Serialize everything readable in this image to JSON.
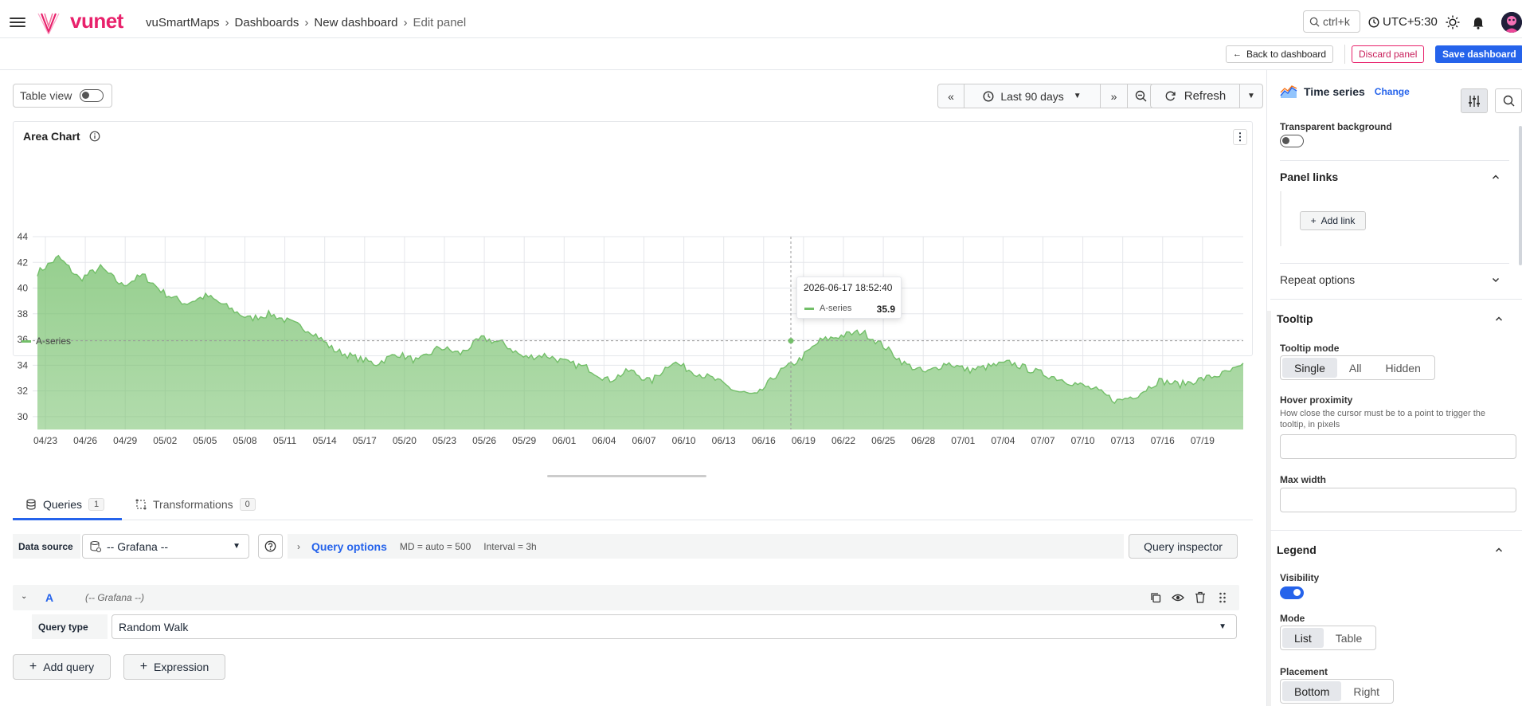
{
  "topbar": {
    "brand": "vunet",
    "breadcrumbs": [
      "vuSmartMaps",
      "Dashboards",
      "New dashboard",
      "Edit panel"
    ],
    "search_label": "ctrl+k",
    "timezone": "UTC+5:30"
  },
  "actionbar": {
    "back_label": "Back to dashboard",
    "discard_label": "Discard panel",
    "save_label": "Save dashboard"
  },
  "toolbar": {
    "table_view_label": "Table view",
    "time_range": "Last 90 days",
    "refresh_label": "Refresh"
  },
  "panel": {
    "title": "Area Chart",
    "tooltip": {
      "time": "2026-06-17 18:52:40",
      "series": "A-series",
      "value": "35.9"
    },
    "legend_label": "A-series"
  },
  "chart_data": {
    "type": "area",
    "series": [
      {
        "name": "A-series",
        "color": "#73bf69"
      }
    ],
    "x_tick_labels": [
      "04/23",
      "04/26",
      "04/29",
      "05/02",
      "05/05",
      "05/08",
      "05/11",
      "05/14",
      "05/17",
      "05/20",
      "05/23",
      "05/26",
      "05/29",
      "06/01",
      "06/04",
      "06/07",
      "06/10",
      "06/13",
      "06/16",
      "06/19",
      "06/22",
      "06/25",
      "06/28",
      "07/01",
      "07/04",
      "07/07",
      "07/10",
      "07/13",
      "07/16",
      "07/19"
    ],
    "y_tick_labels": [
      "44",
      "42",
      "40",
      "38",
      "36",
      "34",
      "32",
      "30"
    ],
    "ylim": [
      29,
      44
    ],
    "values": [
      41.2,
      42.4,
      40.7,
      41.6,
      40.2,
      41.0,
      39.6,
      38.8,
      39.4,
      38.5,
      37.6,
      38.0,
      37.3,
      36.6,
      35.2,
      34.6,
      34.1,
      34.9,
      34.3,
      35.4,
      34.9,
      36.1,
      35.7,
      34.6,
      34.8,
      34.2,
      33.8,
      32.8,
      33.6,
      32.7,
      34.3,
      33.5,
      32.9,
      32.0,
      31.6,
      33.4,
      34.4,
      35.9,
      36.3,
      36.6,
      35.5,
      34.1,
      33.4,
      34.2,
      33.6,
      33.9,
      34.2,
      33.6,
      33.1,
      32.6,
      32.1,
      31.2,
      31.7,
      32.8,
      32.5,
      32.9,
      33.3,
      33.9
    ],
    "grid": true,
    "legend_position": "bottom"
  },
  "queries": {
    "tabs": [
      {
        "label": "Queries",
        "count": "1"
      },
      {
        "label": "Transformations",
        "count": "0"
      }
    ],
    "data_source_label": "Data source",
    "data_source_value": "-- Grafana --",
    "query_options_label": "Query options",
    "md_text": "MD = auto = 500",
    "interval_text": "Interval = 3h",
    "inspector_label": "Query inspector",
    "query_letter": "A",
    "query_ds": "(-- Grafana --)",
    "query_type_label": "Query type",
    "query_type_value": "Random Walk",
    "add_query_label": "Add query",
    "expression_label": "Expression"
  },
  "options": {
    "viz_name": "Time series",
    "change_label": "Change",
    "transparent_label": "Transparent background",
    "panel_links_label": "Panel links",
    "add_link_label": "Add link",
    "repeat_label": "Repeat options",
    "tooltip_label": "Tooltip",
    "tooltip_mode_label": "Tooltip mode",
    "tooltip_modes": [
      "Single",
      "All",
      "Hidden"
    ],
    "hover_label": "Hover proximity",
    "hover_desc": "How close the cursor must be to a point to trigger the tooltip, in pixels",
    "max_width_label": "Max width",
    "legend_label": "Legend",
    "visibility_label": "Visibility",
    "mode_label": "Mode",
    "modes": [
      "List",
      "Table"
    ],
    "placement_label": "Placement",
    "placements": [
      "Bottom",
      "Right"
    ]
  }
}
